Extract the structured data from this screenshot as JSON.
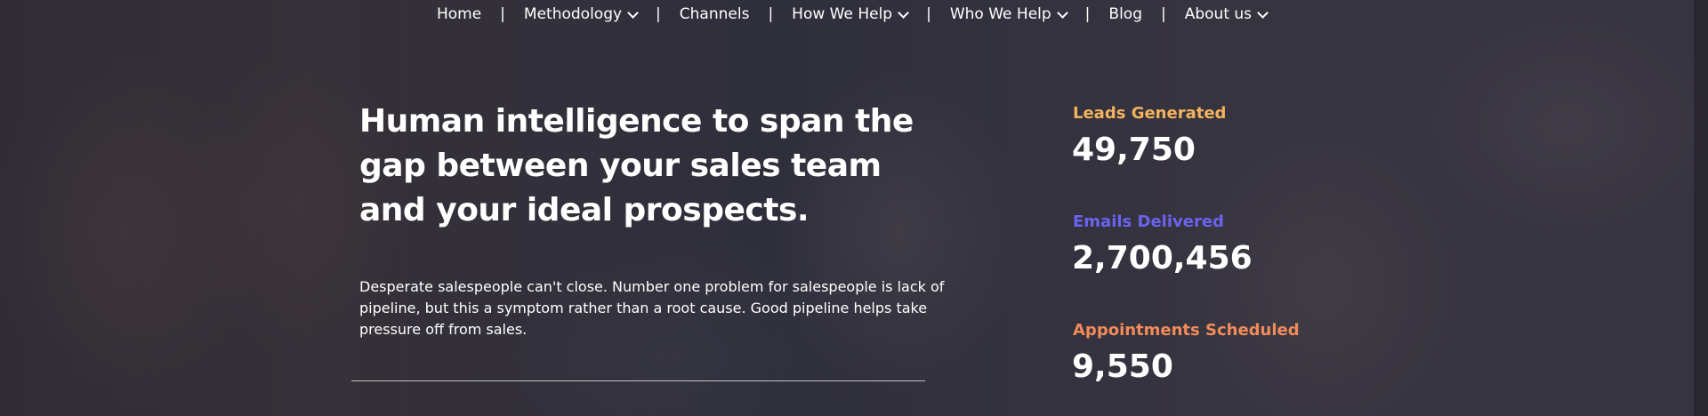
{
  "nav": {
    "items": [
      {
        "label": "Home",
        "has_dropdown": false
      },
      {
        "label": "Methodology",
        "has_dropdown": true
      },
      {
        "label": "Channels",
        "has_dropdown": false
      },
      {
        "label": "How We Help",
        "has_dropdown": true
      },
      {
        "label": "Who We Help",
        "has_dropdown": true
      },
      {
        "label": "Blog",
        "has_dropdown": false
      },
      {
        "label": "About us",
        "has_dropdown": true
      }
    ],
    "separator": "|"
  },
  "hero": {
    "headline": "Human intelligence to span the gap between your sales team and your ideal prospects.",
    "description": "Desperate salespeople can't close. Number one problem for salespeople is lack of pipeline, but this a symptom rather than a root cause. Good pipeline helps take pressure off from sales."
  },
  "stats": [
    {
      "label": "Leads Generated",
      "value": "49,750",
      "color": "#f3b35c"
    },
    {
      "label": "Emails Delivered",
      "value": "2,700,456",
      "color": "#6b63f0"
    },
    {
      "label": "Appointments Scheduled",
      "value": "9,550",
      "color": "#f28b5a"
    }
  ]
}
